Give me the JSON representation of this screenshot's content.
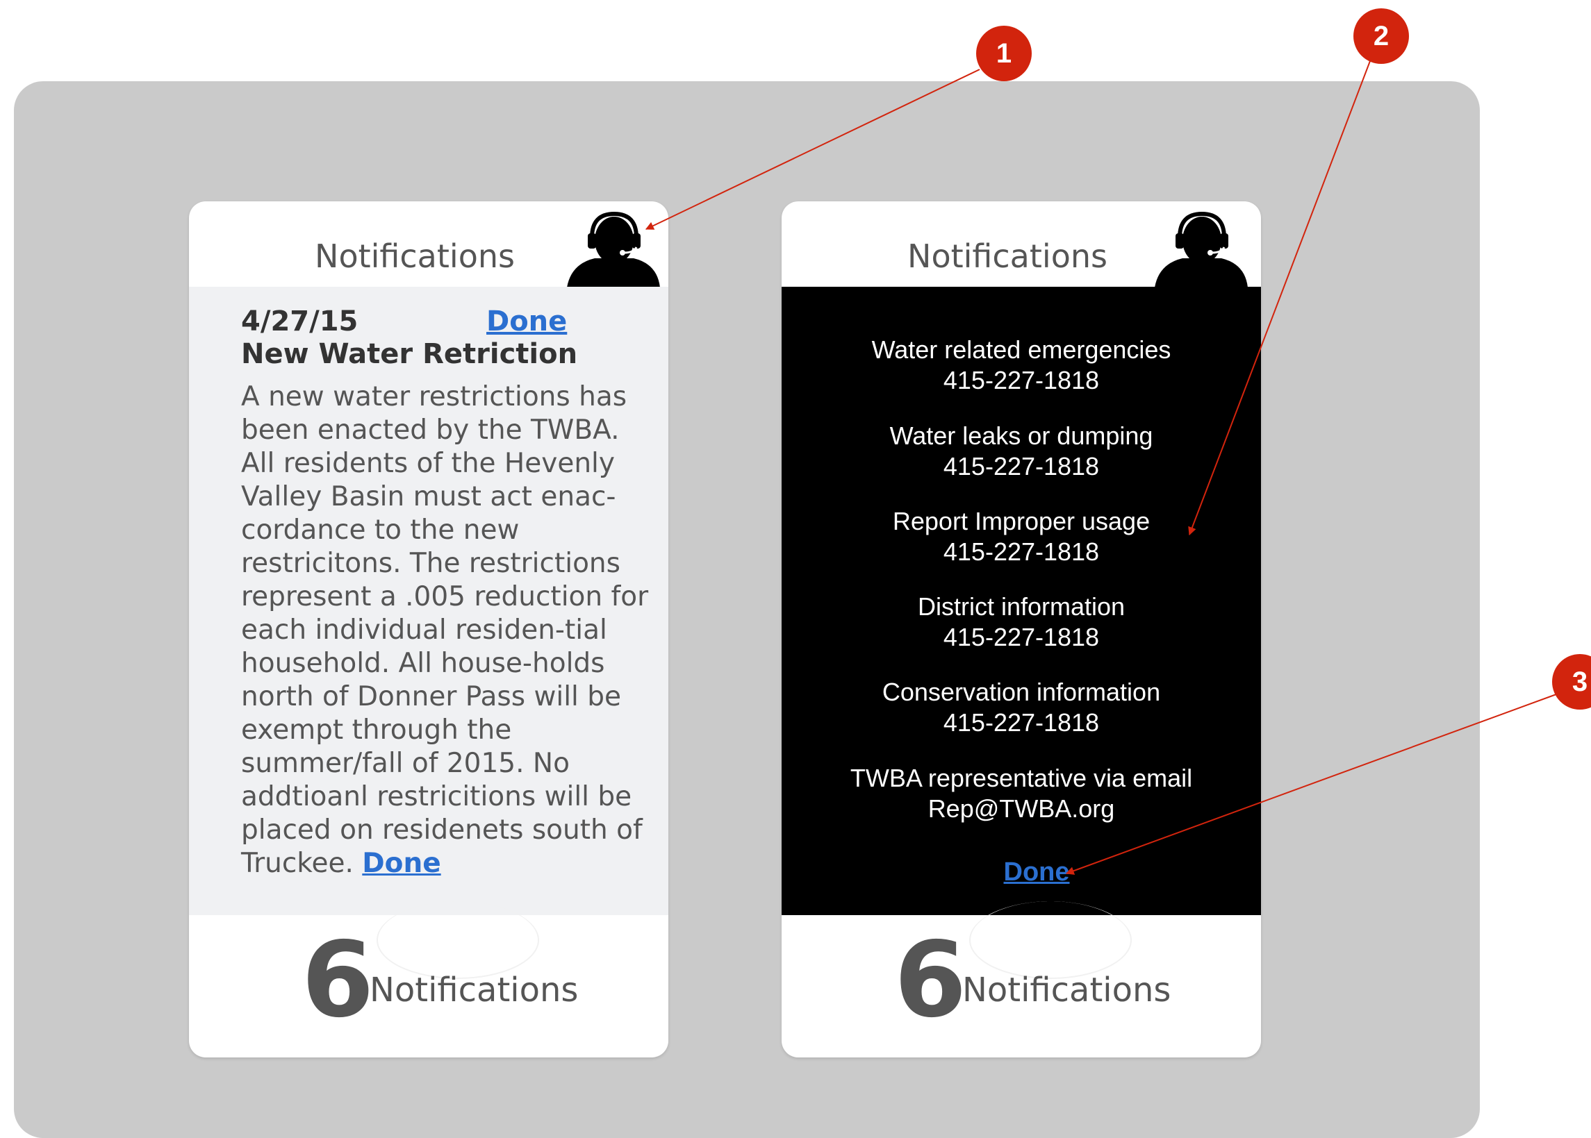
{
  "left_card": {
    "title": "Notifications",
    "date": "4/27/15",
    "done_top": "Done",
    "heading": "New Water Retriction",
    "paragraph": "A new water restrictions has been enacted by the TWBA. All residents of the Hevenly Valley Basin must act enac-cordance to the new restricitons. The restrictions represent a .005 reduction for each individual residen-tial household. All house-holds north of Donner Pass will be exempt through the summer/fall of 2015. No addtioanl restricitions will be placed on residenets south of Truckee.",
    "done_inline": "Done",
    "count": "6",
    "count_label": "Notifications"
  },
  "right_card": {
    "title": "Notifications",
    "contacts": [
      {
        "label": "Water related emergencies",
        "value": "415-227-1818"
      },
      {
        "label": "Water leaks or dumping",
        "value": "415-227-1818"
      },
      {
        "label": "Report Improper usage",
        "value": "415-227-1818"
      },
      {
        "label": "District information",
        "value": "415-227-1818"
      },
      {
        "label": "Conservation information",
        "value": "415-227-1818"
      },
      {
        "label": "TWBA representative via email",
        "value": "Rep@TWBA.org"
      }
    ],
    "done": "Done",
    "count": "6",
    "count_label": "Notifications"
  },
  "markers": [
    "1",
    "2",
    "3"
  ],
  "colors": {
    "marker": "#d2240d",
    "link": "#2b6fd0",
    "backdrop": "#cacaca"
  }
}
